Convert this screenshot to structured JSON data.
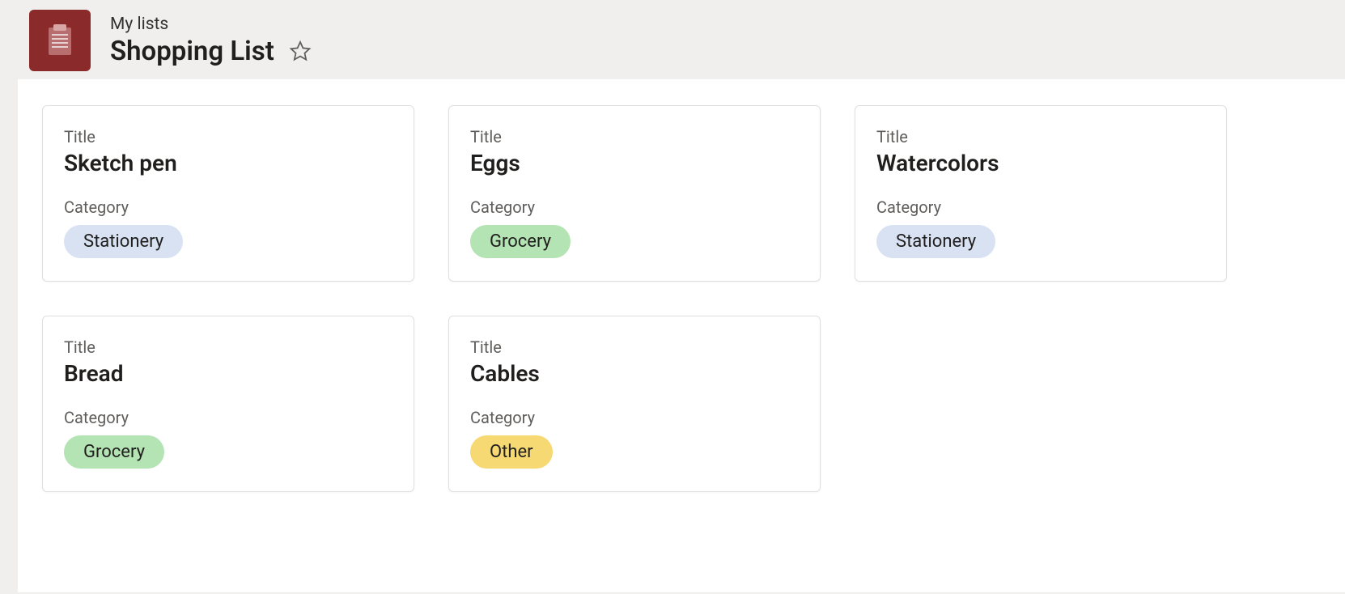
{
  "header": {
    "breadcrumb": "My lists",
    "title": "Shopping List",
    "icon": "clipboard-icon",
    "starred": false
  },
  "labels": {
    "title_field": "Title",
    "category_field": "Category"
  },
  "categories": {
    "stationery": {
      "label": "Stationery",
      "color": "#d9e2f3"
    },
    "grocery": {
      "label": "Grocery",
      "color": "#b4e3b4"
    },
    "other": {
      "label": "Other",
      "color": "#f7d973"
    }
  },
  "items": [
    {
      "title": "Sketch pen",
      "category_key": "stationery"
    },
    {
      "title": "Eggs",
      "category_key": "grocery"
    },
    {
      "title": "Watercolors",
      "category_key": "stationery"
    },
    {
      "title": "Bread",
      "category_key": "grocery"
    },
    {
      "title": "Cables",
      "category_key": "other"
    }
  ]
}
